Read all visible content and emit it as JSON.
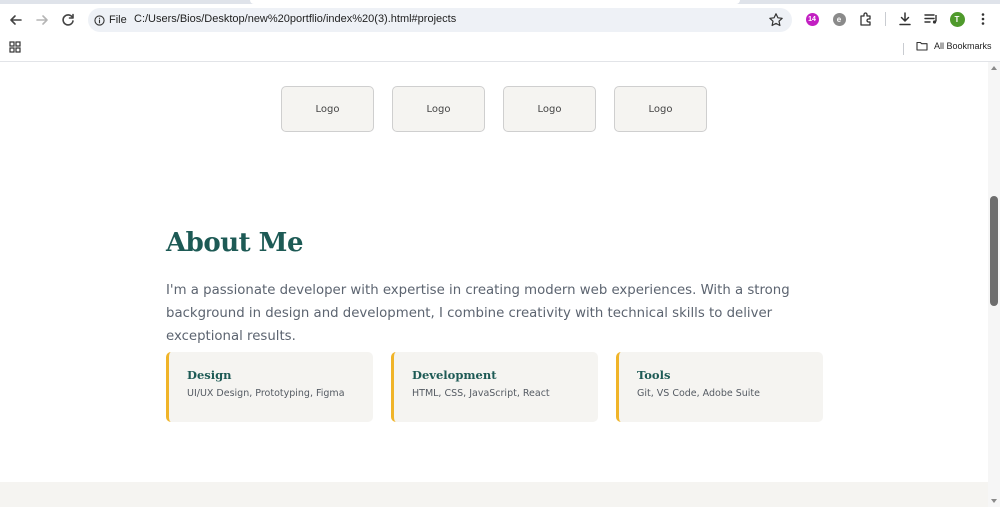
{
  "browser": {
    "site_chip_label": "File",
    "url": "C:/Users/Bios/Desktop/new%20portflio/index%20(3).html#projects",
    "extension_badge_text": "14",
    "profile_initial": "T",
    "all_bookmarks_label": "All Bookmarks"
  },
  "logos": [
    "Logo",
    "Logo",
    "Logo",
    "Logo"
  ],
  "about": {
    "title": "About Me",
    "text": "I'm a passionate developer with expertise in creating modern web experiences. With a strong background in design and development, I combine creativity with technical skills to deliver exceptional results."
  },
  "skills": [
    {
      "title": "Design",
      "items": "UI/UX Design, Prototyping, Figma"
    },
    {
      "title": "Development",
      "items": "HTML, CSS, JavaScript, React"
    },
    {
      "title": "Tools",
      "items": "Git, VS Code, Adobe Suite"
    }
  ],
  "colors": {
    "accent_teal": "#1d5a55",
    "accent_gold": "#f0b429",
    "card_bg": "#f5f4f1"
  }
}
